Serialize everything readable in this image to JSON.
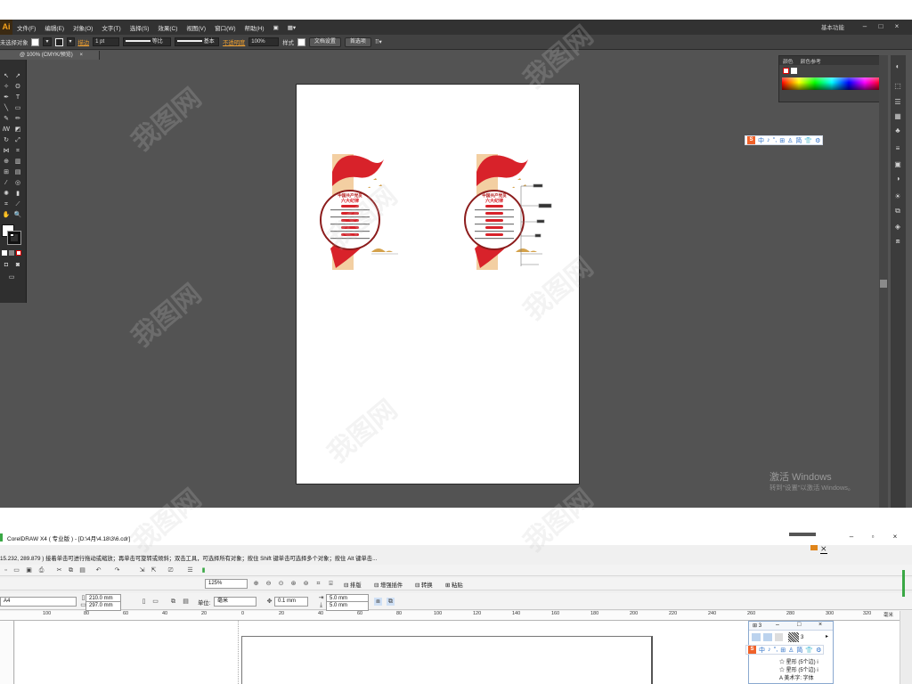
{
  "illustrator": {
    "logo": "Ai",
    "menu": [
      "文件(F)",
      "编辑(E)",
      "对象(O)",
      "文字(T)",
      "选择(S)",
      "效果(C)",
      "视图(V)",
      "窗口(W)",
      "帮助(H)"
    ],
    "workspace": "基本功能",
    "window_buttons": [
      "–",
      "□",
      "×"
    ],
    "control": {
      "selection": "未选择对象",
      "stroke_label": "描边",
      "stroke_weight": "1 pt",
      "profile": "等比",
      "brush": "基本",
      "opacity_label": "不透明度",
      "opacity_value": "100%",
      "style_label": "样式",
      "doc_setup": "文档设置",
      "preferences": "首选项"
    },
    "doc_tab": "@ 100% (CMYK/预览)",
    "doc_tab_close": "×",
    "color_panel": {
      "tabs": [
        "颜色",
        "颜色参考"
      ],
      "menu_icon": "panel-menu"
    },
    "ime_bar": [
      "中",
      "♪",
      "°,",
      "⊞",
      "♙",
      "简",
      "👕",
      "⚙"
    ],
    "activation": {
      "line1": "激活 Windows",
      "line2": "转到\"设置\"以激活 Windows。"
    },
    "colors": {
      "ui_dark": "#535353",
      "accent": "#f7a31b",
      "art_red": "#d8222a",
      "art_gold": "#d4a24c"
    }
  },
  "artwork": {
    "panel_title": "中国共产党员",
    "panel_subtitle": "六大纪律"
  },
  "coreldraw": {
    "title": "CorelDRAW X4 ( 专业版 ) - [D:\\4月\\4.18\\3\\6.cdr]",
    "status": "15.232, 289.879 )     接着单击可进行拖动或缩放；再单击可旋转或倾斜；双击工具，可选择所有对象；按住 Shift 键单击可选择多个对象；按住 Alt 键单击...",
    "zoom": "125%",
    "toolbar2": [
      "排版",
      "增强插件",
      "转换",
      "粘贴"
    ],
    "paper": "A4",
    "width": "210.0 mm",
    "height": "297.0 mm",
    "unit_label": "单位:",
    "unit": "毫米",
    "nudge": "0.1 mm",
    "dup_x": "5.0 mm",
    "dup_y": "5.0 mm",
    "ruler_labels": [
      "100",
      "80",
      "60",
      "40",
      "20",
      "0",
      "20",
      "40",
      "60",
      "80",
      "100",
      "120",
      "140",
      "160",
      "180",
      "200",
      "220",
      "240",
      "260",
      "280",
      "300",
      "320"
    ],
    "ruler_unit": "毫米",
    "docker": {
      "title": "3",
      "label": "3",
      "rows": [
        "星形 (5个边) i",
        "星形 (5个边) i",
        "美术字: 字体"
      ]
    },
    "window_buttons": [
      "–",
      "▫",
      "×"
    ]
  },
  "watermark": "我图网"
}
